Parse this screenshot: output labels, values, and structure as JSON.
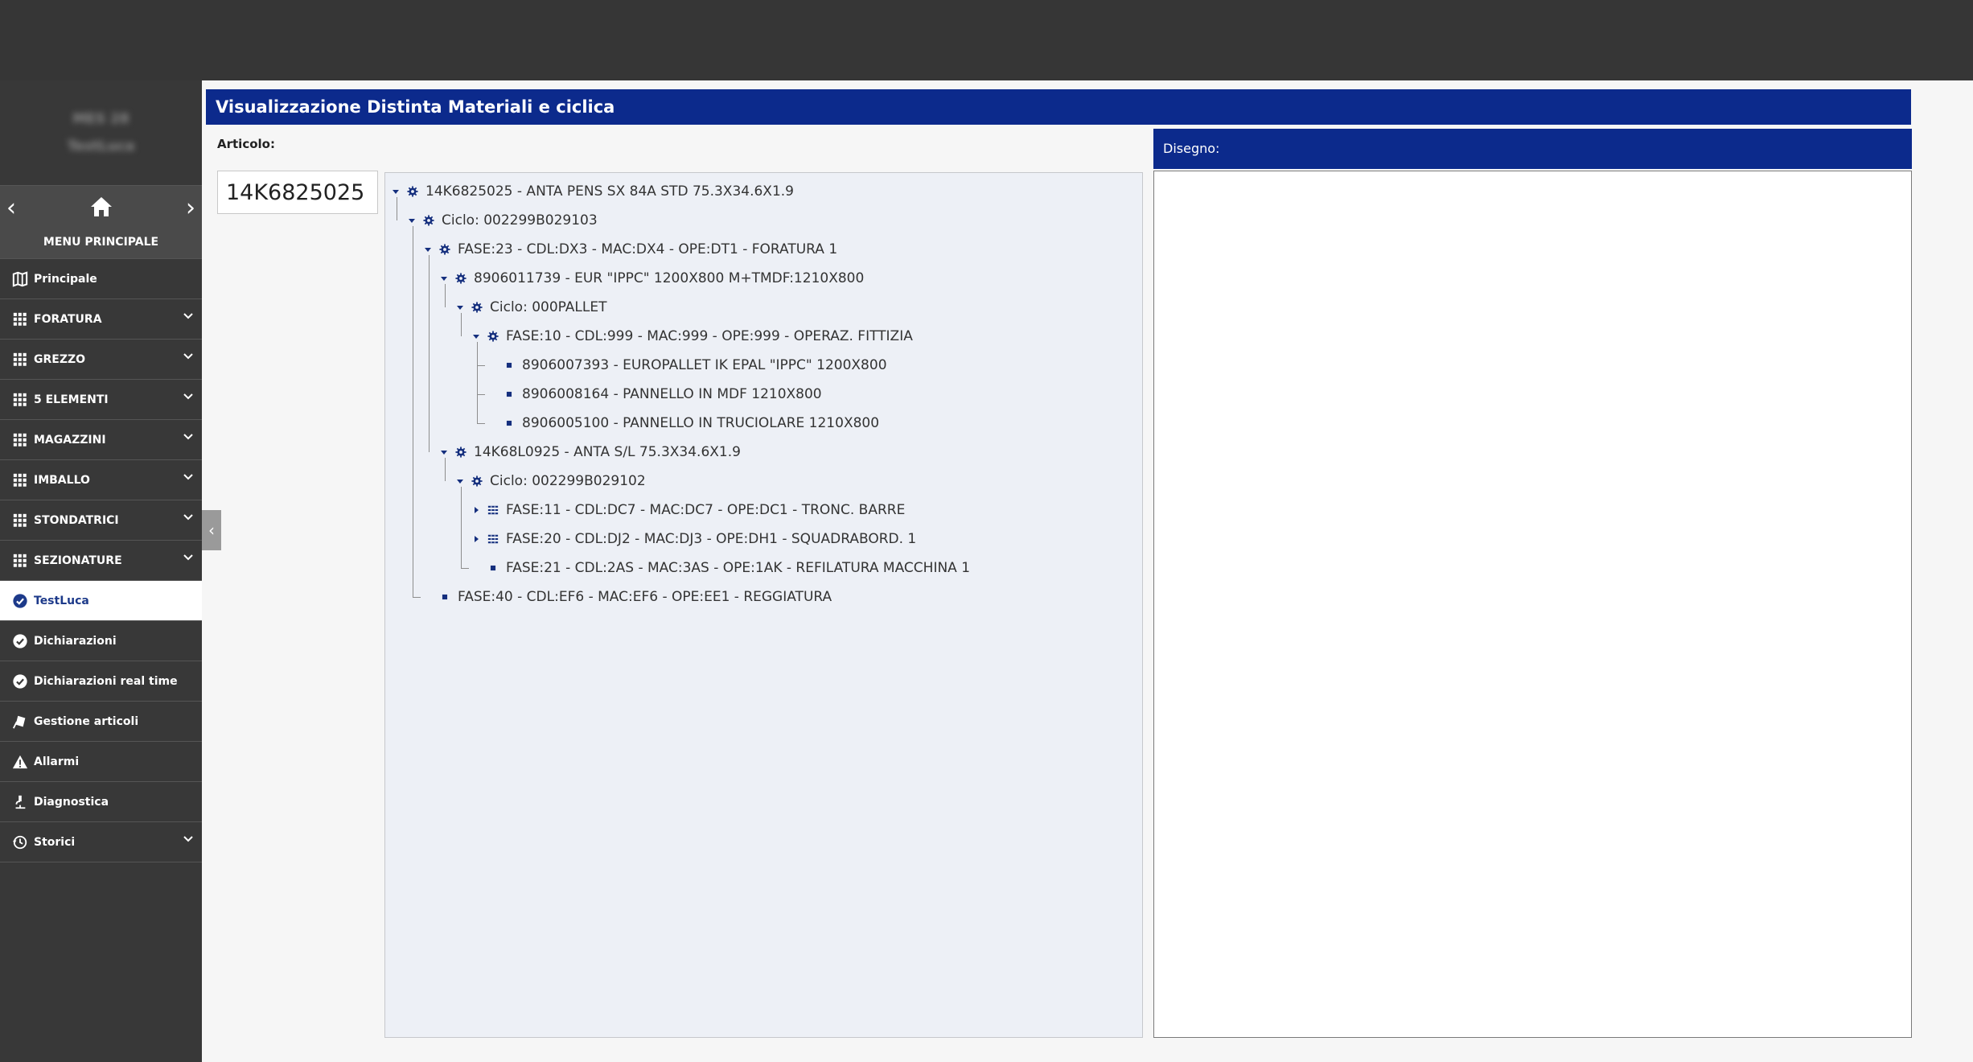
{
  "sidebar": {
    "user_name": "MES 28",
    "user_sub": "TestLuca",
    "home_label": "MENU PRINCIPALE",
    "items": [
      {
        "label": "Principale",
        "icon": "map-icon",
        "chevron": false,
        "active": false
      },
      {
        "label": "FORATURA",
        "icon": "grid-icon",
        "chevron": true,
        "active": false
      },
      {
        "label": "GREZZO",
        "icon": "grid-icon",
        "chevron": true,
        "active": false
      },
      {
        "label": "5 ELEMENTI",
        "icon": "grid-icon",
        "chevron": true,
        "active": false
      },
      {
        "label": "MAGAZZINI",
        "icon": "grid-icon",
        "chevron": true,
        "active": false
      },
      {
        "label": "IMBALLO",
        "icon": "grid-icon",
        "chevron": true,
        "active": false
      },
      {
        "label": "STONDATRICI",
        "icon": "grid-icon",
        "chevron": true,
        "active": false
      },
      {
        "label": "SEZIONATURE",
        "icon": "grid-icon",
        "chevron": true,
        "active": false
      },
      {
        "label": "TestLuca",
        "icon": "check-badge-icon",
        "chevron": false,
        "active": true
      },
      {
        "label": "Dichiarazioni",
        "icon": "check-badge-icon",
        "chevron": false,
        "active": false
      },
      {
        "label": "Dichiarazioni real time",
        "icon": "check-badge-icon",
        "chevron": false,
        "active": false
      },
      {
        "label": "Gestione articoli",
        "icon": "hand-box-icon",
        "chevron": false,
        "active": false
      },
      {
        "label": "Allarmi",
        "icon": "warning-icon",
        "chevron": false,
        "active": false
      },
      {
        "label": "Diagnostica",
        "icon": "microscope-icon",
        "chevron": false,
        "active": false
      },
      {
        "label": "Storici",
        "icon": "history-icon",
        "chevron": true,
        "active": false
      }
    ]
  },
  "header": {
    "title": "Visualizzazione Distinta Materiali e ciclica"
  },
  "articolo": {
    "label": "Articolo:",
    "value": "14K6825025"
  },
  "tree": [
    {
      "text": "14K6825025 - ANTA PENS SX 84A STD 75.3X34.6X1.9",
      "level": 0,
      "toggle": "expanded",
      "icon": "gear-icon"
    },
    {
      "text": "Ciclo: 002299B029103",
      "level": 1,
      "toggle": "expanded",
      "icon": "gear-icon"
    },
    {
      "text": "FASE:23 - CDL:DX3 - MAC:DX4 - OPE:DT1 - FORATURA 1",
      "level": 2,
      "toggle": "expanded",
      "icon": "gear-icon"
    },
    {
      "text": "8906011739 - EUR \"IPPC\" 1200X800 M+TMDF:1210X800",
      "level": 3,
      "toggle": "expanded",
      "icon": "gear-icon"
    },
    {
      "text": "Ciclo: 000PALLET",
      "level": 4,
      "toggle": "expanded",
      "icon": "gear-icon"
    },
    {
      "text": "FASE:10 - CDL:999 - MAC:999 - OPE:999 - OPERAZ. FITTIZIA",
      "level": 5,
      "toggle": "expanded",
      "icon": "gear-icon"
    },
    {
      "text": "8906007393 - EUROPALLET IK EPAL \"IPPC\" 1200X800",
      "level": 6,
      "toggle": "none",
      "icon": "square-icon"
    },
    {
      "text": "8906008164 - PANNELLO IN MDF 1210X800",
      "level": 6,
      "toggle": "none",
      "icon": "square-icon"
    },
    {
      "text": "8906005100 - PANNELLO IN TRUCIOLARE 1210X800",
      "level": 6,
      "toggle": "none",
      "icon": "square-icon"
    },
    {
      "text": "14K68L0925 - ANTA S/L 75.3X34.6X1.9",
      "level": 3,
      "toggle": "expanded",
      "icon": "gear-icon"
    },
    {
      "text": "Ciclo: 002299B029102",
      "level": 4,
      "toggle": "expanded",
      "icon": "gear-icon"
    },
    {
      "text": "FASE:11 - CDL:DC7 - MAC:DC7 - OPE:DC1 - TRONC. BARRE",
      "level": 5,
      "toggle": "collapsed",
      "icon": "list-icon"
    },
    {
      "text": "FASE:20 - CDL:DJ2 - MAC:DJ3 - OPE:DH1 - SQUADRABORD. 1",
      "level": 5,
      "toggle": "collapsed",
      "icon": "list-icon"
    },
    {
      "text": "FASE:21 - CDL:2AS - MAC:3AS - OPE:1AK - REFILATURA MACCHINA 1",
      "level": 5,
      "toggle": "none",
      "icon": "square-icon"
    },
    {
      "text": "FASE:40 - CDL:EF6 - MAC:EF6 - OPE:EE1 - REGGIATURA",
      "level": 2,
      "toggle": "none",
      "icon": "square-icon"
    }
  ],
  "drawing": {
    "label": "Disegno:"
  },
  "colors": {
    "primary": "#0c2a8c",
    "sidebar": "#383838",
    "topbar": "#363636"
  }
}
